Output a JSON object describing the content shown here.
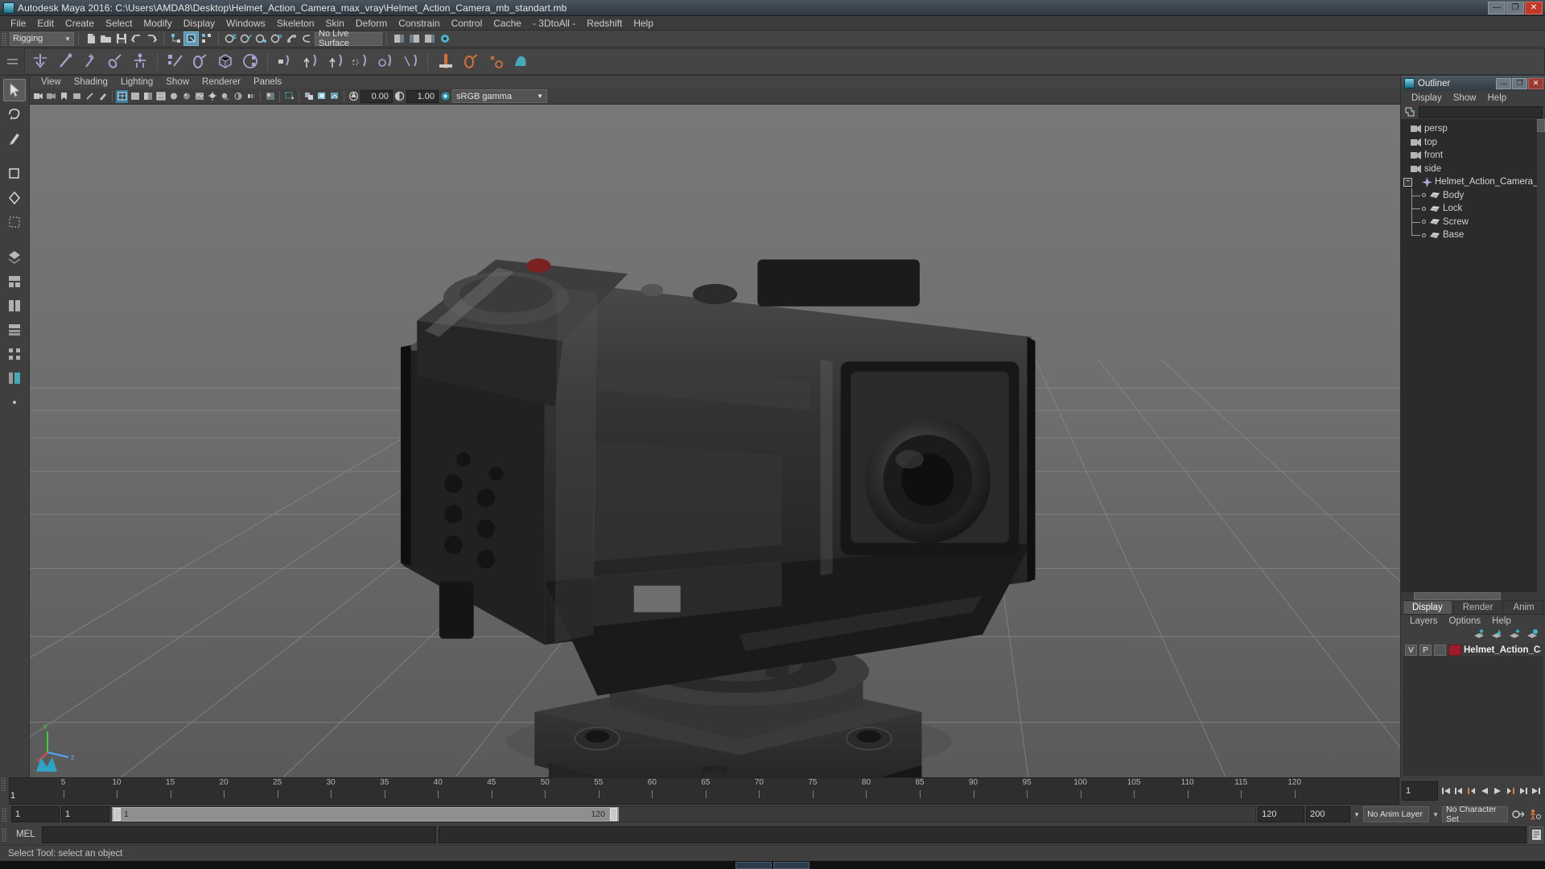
{
  "window": {
    "title": "Autodesk Maya 2016: C:\\Users\\AMDA8\\Desktop\\Helmet_Action_Camera_max_vray\\Helmet_Action_Camera_mb_standart.mb",
    "minimize": "—",
    "maximize": "❐",
    "close": "✕"
  },
  "menubar": {
    "items": [
      "File",
      "Edit",
      "Create",
      "Select",
      "Modify",
      "Display",
      "Windows",
      "Skeleton",
      "Skin",
      "Deform",
      "Constrain",
      "Control",
      "Cache",
      "- 3DtoAll -",
      "Redshift",
      "Help"
    ]
  },
  "statusline": {
    "mode": "Rigging",
    "mode_arrow": "▼",
    "live_surface": "No Live Surface"
  },
  "viewport_menu": {
    "items": [
      "View",
      "Shading",
      "Lighting",
      "Show",
      "Renderer",
      "Panels"
    ]
  },
  "viewport_tools": {
    "exposure": "0.00",
    "gamma": "1.00",
    "color_space": "sRGB gamma",
    "color_space_arrow": "▼"
  },
  "viewport": {
    "camera_label": "persp",
    "axis_x": "x",
    "axis_y": "y",
    "axis_z": "z",
    "background_top": "#757575",
    "background_bottom": "#5e5e5e",
    "grid_color": "#8a8a8a",
    "model_color": "#2b2b2b"
  },
  "outliner": {
    "title": "Outliner",
    "menu": [
      "Display",
      "Show",
      "Help"
    ],
    "search_value": "",
    "search_placeholder": "",
    "minimize": "—",
    "maximize": "❐",
    "close": "✕",
    "expander": "−",
    "items": [
      {
        "label": "persp",
        "icon": "camera-icon",
        "kind": "camera",
        "dim": true
      },
      {
        "label": "top",
        "icon": "camera-icon",
        "kind": "camera",
        "dim": true
      },
      {
        "label": "front",
        "icon": "camera-icon",
        "kind": "camera",
        "dim": true
      },
      {
        "label": "side",
        "icon": "camera-icon",
        "kind": "camera",
        "dim": true
      },
      {
        "label": "Helmet_Action_Camera_n",
        "icon": "group-icon",
        "kind": "group",
        "dim": false
      }
    ],
    "children": [
      {
        "label": "Body",
        "icon": "mesh-icon"
      },
      {
        "label": "Lock",
        "icon": "mesh-icon"
      },
      {
        "label": "Screw",
        "icon": "mesh-icon"
      },
      {
        "label": "Base",
        "icon": "mesh-icon"
      }
    ]
  },
  "layer_editor": {
    "tabs": [
      "Display",
      "Render",
      "Anim"
    ],
    "active_tab": "Display",
    "menu": [
      "Layers",
      "Options",
      "Help"
    ],
    "layers": [
      {
        "visible": "V",
        "playback": "P",
        "color": "#9e1c28",
        "name": "Helmet_Action_Camera"
      }
    ]
  },
  "timeline": {
    "ticks": [
      "5",
      "10",
      "15",
      "20",
      "25",
      "30",
      "35",
      "40",
      "45",
      "50",
      "55",
      "60",
      "65",
      "70",
      "75",
      "80",
      "85",
      "90",
      "95",
      "100",
      "105",
      "110",
      "115",
      "120"
    ],
    "current_frame_label": "1",
    "current_frame_field": "1",
    "start_field": "1",
    "end_field": "1",
    "range_start_label": "1",
    "range_end_label": "120",
    "playback_end": "120",
    "anim_end": "200",
    "anim_layer": "No Anim Layer",
    "character_set": "No Character Set"
  },
  "command_line": {
    "label": "MEL",
    "input_value": "",
    "output_value": ""
  },
  "help_line": {
    "text": "Select Tool: select an object"
  }
}
